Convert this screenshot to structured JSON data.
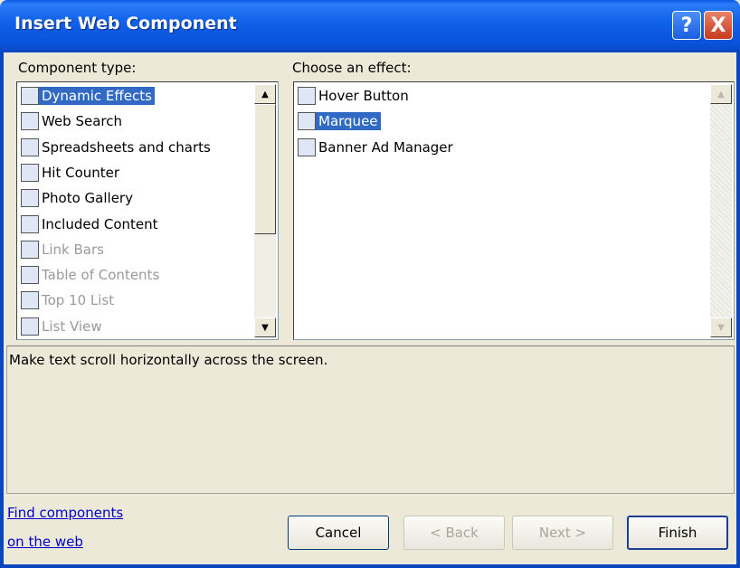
{
  "window": {
    "title": "Insert Web Component",
    "help_label": "?",
    "close_label": "X"
  },
  "component_type": {
    "label": "Component type:",
    "items": [
      {
        "label": "Dynamic Effects",
        "icon": "dynamic-effects-icon",
        "selected": true,
        "enabled": true
      },
      {
        "label": "Web Search",
        "icon": "web-search-icon",
        "selected": false,
        "enabled": true
      },
      {
        "label": "Spreadsheets and charts",
        "icon": "spreadsheets-icon",
        "selected": false,
        "enabled": true
      },
      {
        "label": "Hit Counter",
        "icon": "hit-counter-icon",
        "selected": false,
        "enabled": true
      },
      {
        "label": "Photo Gallery",
        "icon": "photo-gallery-icon",
        "selected": false,
        "enabled": true
      },
      {
        "label": "Included Content",
        "icon": "included-content-icon",
        "selected": false,
        "enabled": true
      },
      {
        "label": "Link Bars",
        "icon": "link-bars-icon",
        "selected": false,
        "enabled": false
      },
      {
        "label": "Table of Contents",
        "icon": "table-of-contents-icon",
        "selected": false,
        "enabled": false
      },
      {
        "label": "Top 10 List",
        "icon": "top-10-list-icon",
        "selected": false,
        "enabled": false
      },
      {
        "label": "List View",
        "icon": "list-view-icon",
        "selected": false,
        "enabled": false
      }
    ]
  },
  "effect": {
    "label": "Choose an effect:",
    "items": [
      {
        "label": "Hover Button",
        "icon": "hover-button-icon",
        "selected": false
      },
      {
        "label": "Marquee",
        "icon": "marquee-icon",
        "selected": true
      },
      {
        "label": "Banner Ad Manager",
        "icon": "banner-ad-icon",
        "selected": false
      }
    ]
  },
  "description": "Make text scroll horizontally across the screen.",
  "links": {
    "line1": "Find components",
    "line2": "on the web"
  },
  "buttons": {
    "cancel": "Cancel",
    "back": "< Back",
    "next": "Next >",
    "finish": "Finish"
  },
  "colors": {
    "titlebar": "#0a5ae6",
    "selection": "#316ac5",
    "dialog_bg": "#ece9d8"
  }
}
